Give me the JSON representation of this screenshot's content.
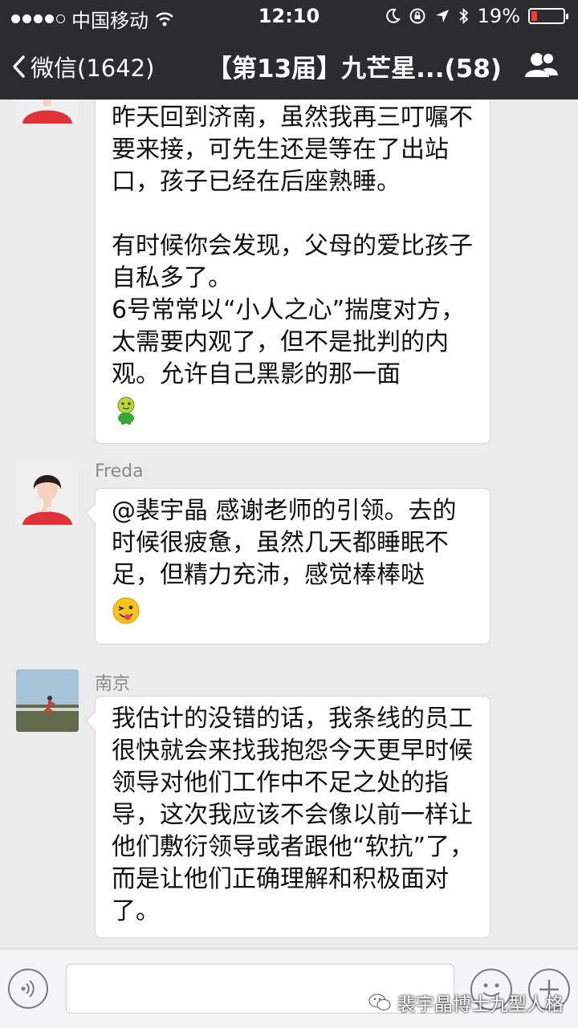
{
  "status_bar": {
    "carrier": "中国移动",
    "time": "12:10",
    "battery_percent_text": "19%",
    "battery_level": 0.19,
    "signal_bars_filled": 4,
    "icons": [
      "wifi-icon",
      "moon-icon",
      "rotation-lock-icon",
      "location-arrow-icon",
      "bluetooth-icon",
      "battery-icon"
    ]
  },
  "nav": {
    "back_label": "微信(1642)",
    "title": "【第13届】九芒星...(58)",
    "right_icon": "group-members-icon"
  },
  "messages": [
    {
      "sender": "",
      "avatar": "avatar-woman-red-shirt",
      "paragraphs": [
        "昨天回到济南，虽然我再三叮嘱不要来接，可先生还是等在了出站口，孩子已经在后座熟睡。",
        "",
        "有时候你会发现，父母的爱比孩子自私多了。",
        "6号常常以“小人之心”揣度对方，太需要内观了，但不是批判的内观。允许自己黑影的那一面"
      ],
      "emoji": "green-man-emoji"
    },
    {
      "sender": "Freda",
      "avatar": "avatar-woman-red-shirt",
      "paragraphs": [
        "@裴宇晶 感谢老师的引领。去的时候很疲惫，虽然几天都睡眠不足，但精力充沛，感觉棒棒哒"
      ],
      "emoji": "wink-tongue-emoji"
    },
    {
      "sender": "南京",
      "avatar": "avatar-landscape-runner",
      "paragraphs": [
        "我估计的没错的话，我条线的员工很快就会来找我抱怨今天更早时候领导对他们工作中不足之处的指导，这次我应该不会像以前一样让他们敷衍领导或者跟他“软抗”了，而是让他们正确理解和积极面对了。"
      ]
    }
  ],
  "input_bar": {
    "icons": [
      "voice-icon",
      "emoji-icon",
      "plus-icon"
    ]
  },
  "watermark": {
    "text": "裴宇晶博士九型人格",
    "icon": "wechat-icon"
  }
}
